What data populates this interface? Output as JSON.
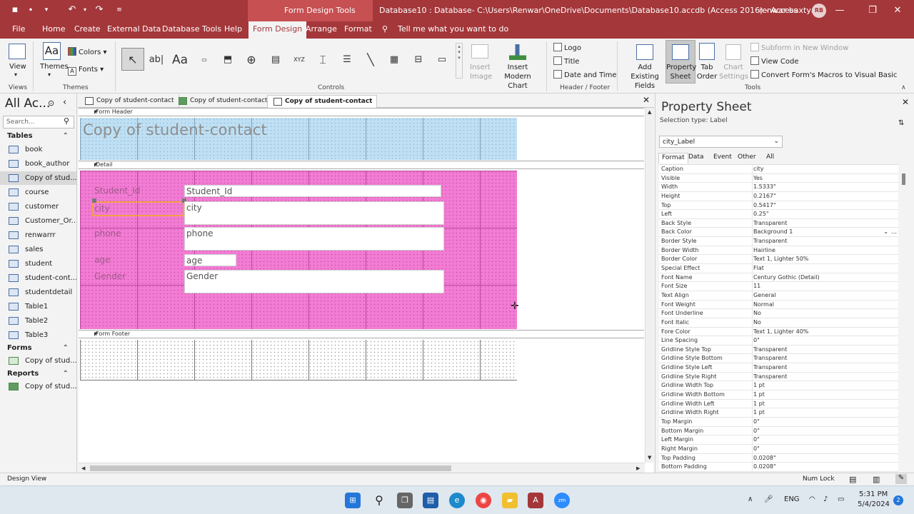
{
  "titlebar": {
    "contextual_title": "Form Design Tools",
    "window_title": "Database10 : Database- C:\\Users\\Renwar\\OneDrive\\Documents\\Database10.accdb (Access 2016)  -  Access",
    "user_name": "renwar baxtyar",
    "user_initials": "RB"
  },
  "ribbon_tabs": [
    "File",
    "Home",
    "Create",
    "External Data",
    "Database Tools",
    "Help",
    "Form Design",
    "Arrange",
    "Format"
  ],
  "tell_me": "Tell me what you want to do",
  "ribbon": {
    "views": {
      "view_label": "View",
      "group": "Views"
    },
    "themes": {
      "themes_label": "Themes",
      "colors_label": "Colors",
      "fonts_label": "Fonts",
      "group": "Themes"
    },
    "controls": {
      "group": "Controls",
      "insert_image": "Insert Image",
      "insert_chart": "Insert Modern Chart"
    },
    "header_footer": {
      "logo": "Logo",
      "title": "Title",
      "date_time": "Date and Time",
      "group": "Header / Footer"
    },
    "tools": {
      "add_existing": "Add Existing Fields",
      "property_sheet": "Property Sheet",
      "tab_order": "Tab Order",
      "chart_settings": "Chart Settings",
      "subform": "Subform in New Window",
      "view_code": "View Code",
      "convert_macros": "Convert Form's Macros to Visual Basic",
      "group": "Tools"
    }
  },
  "nav": {
    "title": "All Ac...",
    "search_placeholder": "Search...",
    "tables_header": "Tables",
    "tables": [
      "book",
      "book_author",
      "Copy of stud...",
      "course",
      "customer",
      "Customer_Or...",
      "renwarrr",
      "sales",
      "student",
      "student-cont...",
      "studentdetail",
      "Table1",
      "Table2",
      "Table3"
    ],
    "forms_header": "Forms",
    "forms": [
      "Copy of stud..."
    ],
    "reports_header": "Reports",
    "reports": [
      "Copy of stud..."
    ]
  },
  "doc_tabs": [
    "Copy of student-contact",
    "Copy of student-contact",
    "Copy of student-contact"
  ],
  "design": {
    "form_header": "Form Header",
    "detail": "Detail",
    "form_footer": "Form Footer",
    "form_title": "Copy of student-contact",
    "labels": [
      "Student_Id",
      "city",
      "phone",
      "age",
      "Gender"
    ],
    "textboxes": [
      "Student_Id",
      "city",
      "phone",
      "age",
      "Gender"
    ]
  },
  "property_sheet": {
    "title": "Property Sheet",
    "selection_type": "Selection type:  Label",
    "selected_control": "city_Label",
    "tabs": [
      "Format",
      "Data",
      "Event",
      "Other",
      "All"
    ],
    "rows": [
      [
        "Caption",
        "city"
      ],
      [
        "Visible",
        "Yes"
      ],
      [
        "Width",
        "1.5333\""
      ],
      [
        "Height",
        "0.2167\""
      ],
      [
        "Top",
        "0.5417\""
      ],
      [
        "Left",
        "0.25\""
      ],
      [
        "Back Style",
        "Transparent"
      ],
      [
        "Back Color",
        "Background 1"
      ],
      [
        "Border Style",
        "Transparent"
      ],
      [
        "Border Width",
        "Hairline"
      ],
      [
        "Border Color",
        "Text 1, Lighter 50%"
      ],
      [
        "Special Effect",
        "Flat"
      ],
      [
        "Font Name",
        "Century Gothic (Detail)"
      ],
      [
        "Font Size",
        "11"
      ],
      [
        "Text Align",
        "General"
      ],
      [
        "Font Weight",
        "Normal"
      ],
      [
        "Font Underline",
        "No"
      ],
      [
        "Font Italic",
        "No"
      ],
      [
        "Fore Color",
        "Text 1, Lighter 40%"
      ],
      [
        "Line Spacing",
        "0\""
      ],
      [
        "Gridline Style Top",
        "Transparent"
      ],
      [
        "Gridline Style Bottom",
        "Transparent"
      ],
      [
        "Gridline Style Left",
        "Transparent"
      ],
      [
        "Gridline Style Right",
        "Transparent"
      ],
      [
        "Gridline Width Top",
        "1 pt"
      ],
      [
        "Gridline Width Bottom",
        "1 pt"
      ],
      [
        "Gridline Width Left",
        "1 pt"
      ],
      [
        "Gridline Width Right",
        "1 pt"
      ],
      [
        "Top Margin",
        "0\""
      ],
      [
        "Bottom Margin",
        "0\""
      ],
      [
        "Left Margin",
        "0\""
      ],
      [
        "Right Margin",
        "0\""
      ],
      [
        "Top Padding",
        "0.0208\""
      ],
      [
        "Bottom Padding",
        "0.0208\""
      ]
    ]
  },
  "status": {
    "left": "Design View",
    "num_lock": "Num Lock"
  },
  "taskbar": {
    "lang": "ENG",
    "time": "5:31 PM",
    "date": "5/4/2024",
    "badge": "2"
  },
  "colors": {
    "access_red": "#a4373a",
    "header_blue": "#bfe0f4",
    "detail_pink": "#f27cd3"
  }
}
